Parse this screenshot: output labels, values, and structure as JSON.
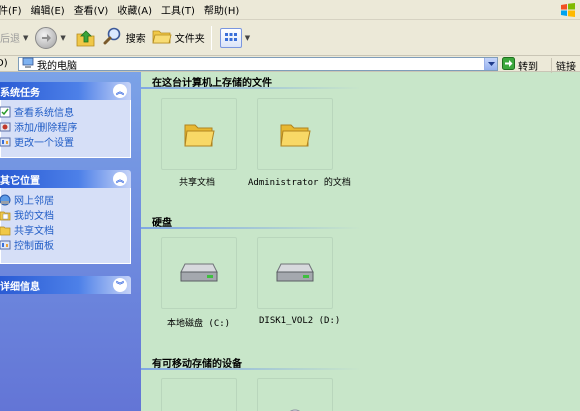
{
  "menu": {
    "items": [
      "件(F)",
      "编辑(E)",
      "查看(V)",
      "收藏(A)",
      "工具(T)",
      "帮助(H)"
    ]
  },
  "toolbar": {
    "back_label": "后退",
    "search_label": "搜索",
    "folders_label": "文件夹"
  },
  "address": {
    "label": "D)",
    "value": "我的电脑",
    "go_label": "转到",
    "links_label": "链接"
  },
  "sidebar": {
    "system_tasks": {
      "title": "系统任务",
      "items": [
        "查看系统信息",
        "添加/删除程序",
        "更改一个设置"
      ]
    },
    "other_places": {
      "title": "其它位置",
      "items": [
        "网上邻居",
        "我的文档",
        "共享文档",
        "控制面板"
      ]
    },
    "details": {
      "title": "详细信息"
    }
  },
  "main": {
    "groups": [
      {
        "title": "在这台计算机上存储的文件",
        "items": [
          "共享文档",
          "Administrator 的文档"
        ]
      },
      {
        "title": "硬盘",
        "items": [
          "本地磁盘 (C:)",
          "DISK1_VOL2 (D:)"
        ]
      },
      {
        "title": "有可移动存储的设备",
        "items": [
          "",
          ""
        ]
      }
    ]
  },
  "colors": {
    "content_bg": "#c8e6c9",
    "sidebar_gradient_top": "#7ba2e7",
    "sidebar_gradient_bottom": "#6375d6",
    "task_link": "#215dc6",
    "chrome": "#ece9d8"
  },
  "icons": {
    "back": "back-arrow-icon",
    "forward": "forward-arrow-icon",
    "up": "folder-up-icon",
    "search": "search-icon",
    "folders": "folders-icon",
    "views": "views-icon",
    "go": "go-arrow-icon"
  }
}
